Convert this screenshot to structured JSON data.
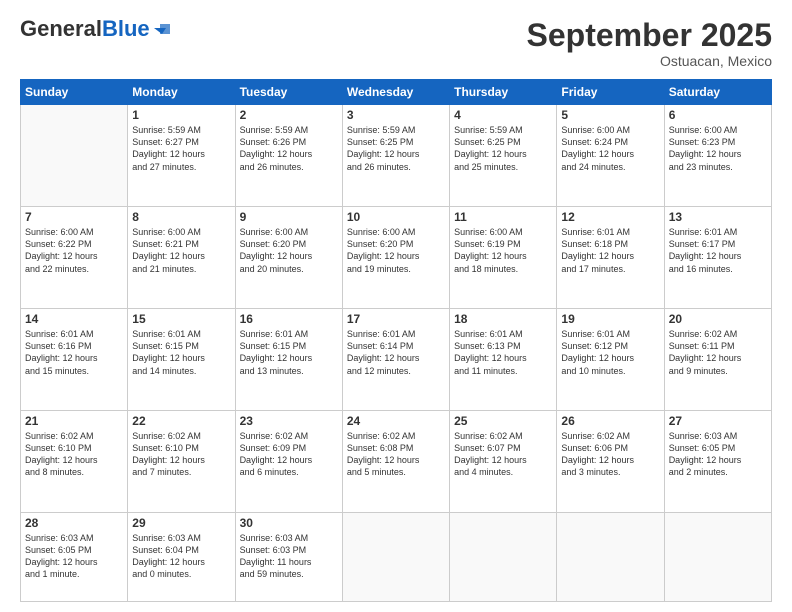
{
  "logo": {
    "general": "General",
    "blue": "Blue"
  },
  "header": {
    "month": "September 2025",
    "location": "Ostuacan, Mexico"
  },
  "weekdays": [
    "Sunday",
    "Monday",
    "Tuesday",
    "Wednesday",
    "Thursday",
    "Friday",
    "Saturday"
  ],
  "weeks": [
    [
      {
        "day": "",
        "info": ""
      },
      {
        "day": "1",
        "info": "Sunrise: 5:59 AM\nSunset: 6:27 PM\nDaylight: 12 hours\nand 27 minutes."
      },
      {
        "day": "2",
        "info": "Sunrise: 5:59 AM\nSunset: 6:26 PM\nDaylight: 12 hours\nand 26 minutes."
      },
      {
        "day": "3",
        "info": "Sunrise: 5:59 AM\nSunset: 6:25 PM\nDaylight: 12 hours\nand 26 minutes."
      },
      {
        "day": "4",
        "info": "Sunrise: 5:59 AM\nSunset: 6:25 PM\nDaylight: 12 hours\nand 25 minutes."
      },
      {
        "day": "5",
        "info": "Sunrise: 6:00 AM\nSunset: 6:24 PM\nDaylight: 12 hours\nand 24 minutes."
      },
      {
        "day": "6",
        "info": "Sunrise: 6:00 AM\nSunset: 6:23 PM\nDaylight: 12 hours\nand 23 minutes."
      }
    ],
    [
      {
        "day": "7",
        "info": "Sunrise: 6:00 AM\nSunset: 6:22 PM\nDaylight: 12 hours\nand 22 minutes."
      },
      {
        "day": "8",
        "info": "Sunrise: 6:00 AM\nSunset: 6:21 PM\nDaylight: 12 hours\nand 21 minutes."
      },
      {
        "day": "9",
        "info": "Sunrise: 6:00 AM\nSunset: 6:20 PM\nDaylight: 12 hours\nand 20 minutes."
      },
      {
        "day": "10",
        "info": "Sunrise: 6:00 AM\nSunset: 6:20 PM\nDaylight: 12 hours\nand 19 minutes."
      },
      {
        "day": "11",
        "info": "Sunrise: 6:00 AM\nSunset: 6:19 PM\nDaylight: 12 hours\nand 18 minutes."
      },
      {
        "day": "12",
        "info": "Sunrise: 6:01 AM\nSunset: 6:18 PM\nDaylight: 12 hours\nand 17 minutes."
      },
      {
        "day": "13",
        "info": "Sunrise: 6:01 AM\nSunset: 6:17 PM\nDaylight: 12 hours\nand 16 minutes."
      }
    ],
    [
      {
        "day": "14",
        "info": "Sunrise: 6:01 AM\nSunset: 6:16 PM\nDaylight: 12 hours\nand 15 minutes."
      },
      {
        "day": "15",
        "info": "Sunrise: 6:01 AM\nSunset: 6:15 PM\nDaylight: 12 hours\nand 14 minutes."
      },
      {
        "day": "16",
        "info": "Sunrise: 6:01 AM\nSunset: 6:15 PM\nDaylight: 12 hours\nand 13 minutes."
      },
      {
        "day": "17",
        "info": "Sunrise: 6:01 AM\nSunset: 6:14 PM\nDaylight: 12 hours\nand 12 minutes."
      },
      {
        "day": "18",
        "info": "Sunrise: 6:01 AM\nSunset: 6:13 PM\nDaylight: 12 hours\nand 11 minutes."
      },
      {
        "day": "19",
        "info": "Sunrise: 6:01 AM\nSunset: 6:12 PM\nDaylight: 12 hours\nand 10 minutes."
      },
      {
        "day": "20",
        "info": "Sunrise: 6:02 AM\nSunset: 6:11 PM\nDaylight: 12 hours\nand 9 minutes."
      }
    ],
    [
      {
        "day": "21",
        "info": "Sunrise: 6:02 AM\nSunset: 6:10 PM\nDaylight: 12 hours\nand 8 minutes."
      },
      {
        "day": "22",
        "info": "Sunrise: 6:02 AM\nSunset: 6:10 PM\nDaylight: 12 hours\nand 7 minutes."
      },
      {
        "day": "23",
        "info": "Sunrise: 6:02 AM\nSunset: 6:09 PM\nDaylight: 12 hours\nand 6 minutes."
      },
      {
        "day": "24",
        "info": "Sunrise: 6:02 AM\nSunset: 6:08 PM\nDaylight: 12 hours\nand 5 minutes."
      },
      {
        "day": "25",
        "info": "Sunrise: 6:02 AM\nSunset: 6:07 PM\nDaylight: 12 hours\nand 4 minutes."
      },
      {
        "day": "26",
        "info": "Sunrise: 6:02 AM\nSunset: 6:06 PM\nDaylight: 12 hours\nand 3 minutes."
      },
      {
        "day": "27",
        "info": "Sunrise: 6:03 AM\nSunset: 6:05 PM\nDaylight: 12 hours\nand 2 minutes."
      }
    ],
    [
      {
        "day": "28",
        "info": "Sunrise: 6:03 AM\nSunset: 6:05 PM\nDaylight: 12 hours\nand 1 minute."
      },
      {
        "day": "29",
        "info": "Sunrise: 6:03 AM\nSunset: 6:04 PM\nDaylight: 12 hours\nand 0 minutes."
      },
      {
        "day": "30",
        "info": "Sunrise: 6:03 AM\nSunset: 6:03 PM\nDaylight: 11 hours\nand 59 minutes."
      },
      {
        "day": "",
        "info": ""
      },
      {
        "day": "",
        "info": ""
      },
      {
        "day": "",
        "info": ""
      },
      {
        "day": "",
        "info": ""
      }
    ]
  ]
}
